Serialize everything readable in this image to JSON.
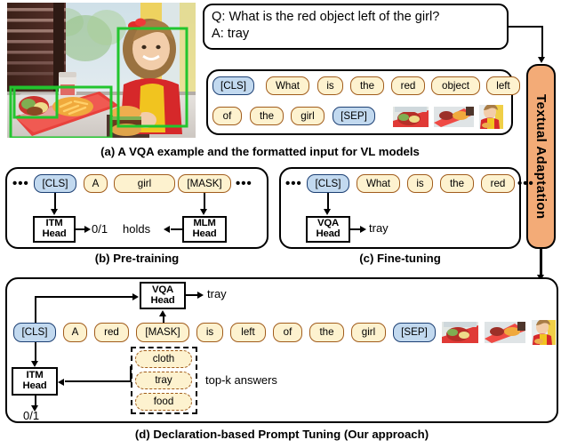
{
  "figure": {
    "panels": [
      {
        "id": "a",
        "caption": "(a) A VQA example and the formatted input for VL models"
      },
      {
        "id": "b",
        "caption": "(b) Pre-training"
      },
      {
        "id": "c",
        "caption": "(c) Fine-tuning"
      },
      {
        "id": "d",
        "caption": "(d) Declaration-based Prompt Tuning (Our approach)"
      }
    ]
  },
  "panel_a": {
    "image_alt": "girl-at-table-with-tray-photo",
    "boxes": [
      "green-box-girl",
      "green-box-tray",
      "green-box-salad"
    ],
    "qa": {
      "question": "Q: What is the red object left of the girl?",
      "answer": "A: tray"
    },
    "tokens_row1": [
      "[CLS]",
      "What",
      "is",
      "the",
      "red",
      "object",
      "left"
    ],
    "tokens_row2": [
      "of",
      "the",
      "girl",
      "[SEP]"
    ],
    "thumbs": [
      "thumb-salad",
      "thumb-tray",
      "thumb-girl"
    ]
  },
  "adaptation": {
    "label": "Textual Adaptation"
  },
  "panel_b": {
    "ellipsis_left": "•••",
    "ellipsis_right": "•••",
    "tokens": [
      "[CLS]",
      "A",
      "girl",
      "[MASK]"
    ],
    "itm_head": {
      "line1": "ITM",
      "line2": "Head"
    },
    "mlm_head": {
      "line1": "MLM",
      "line2": "Head"
    },
    "itm_output": "0/1",
    "mlm_output": "holds"
  },
  "panel_c": {
    "ellipsis_left": "•••",
    "ellipsis_right": "•••",
    "tokens": [
      "[CLS]",
      "What",
      "is",
      "the",
      "red"
    ],
    "vqa_head": {
      "line1": "VQA",
      "line2": "Head"
    },
    "vqa_output": "tray"
  },
  "panel_d": {
    "tokens": [
      "[CLS]",
      "A",
      "red",
      "[MASK]",
      "is",
      "left",
      "of",
      "the",
      "girl",
      "[SEP]"
    ],
    "thumbs": [
      "thumb-salad",
      "thumb-tray",
      "thumb-girl"
    ],
    "vqa_head": {
      "line1": "VQA",
      "line2": "Head"
    },
    "vqa_output": "tray",
    "itm_head": {
      "line1": "ITM",
      "line2": "Head"
    },
    "itm_output": "0/1",
    "topk_answers": [
      "cloth",
      "tray",
      "food"
    ],
    "topk_label": "top-k answers"
  },
  "colors": {
    "word_chip_fill": "#fdf2cf",
    "word_chip_border": "#a15c1c",
    "special_chip_fill": "#c2d9ef",
    "special_chip_border": "#1c3f73",
    "adaptation_fill": "#f3ab77",
    "bbox_green": "#22c52e",
    "stroke": "#000000"
  }
}
